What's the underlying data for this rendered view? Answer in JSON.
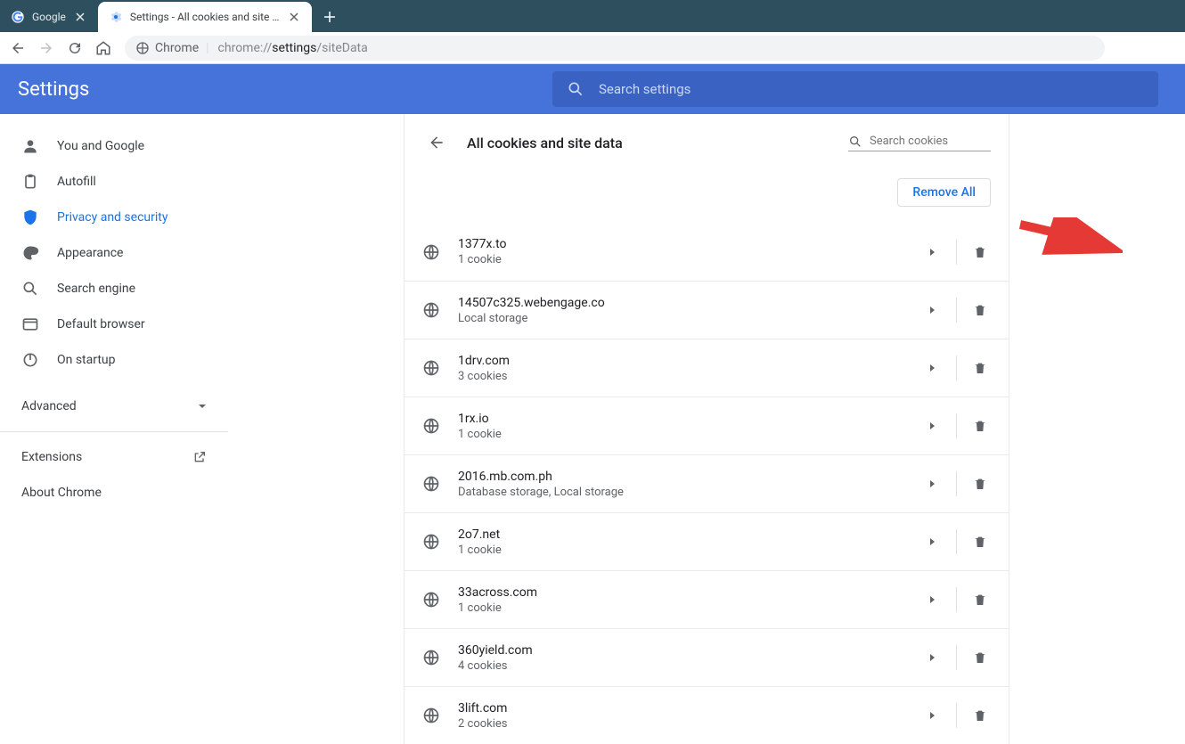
{
  "tabs": [
    {
      "title": "Google",
      "active": false
    },
    {
      "title": "Settings - All cookies and site da",
      "active": true
    }
  ],
  "omnibox": {
    "origin_label": "Chrome",
    "url_prefix": "chrome://",
    "url_bold": "settings",
    "url_suffix": "/siteData"
  },
  "header": {
    "title": "Settings",
    "search_placeholder": "Search settings"
  },
  "sidebar": {
    "items": [
      {
        "label": "You and Google",
        "icon": "person"
      },
      {
        "label": "Autofill",
        "icon": "clipboard"
      },
      {
        "label": "Privacy and security",
        "icon": "shield",
        "active": true
      },
      {
        "label": "Appearance",
        "icon": "palette"
      },
      {
        "label": "Search engine",
        "icon": "search"
      },
      {
        "label": "Default browser",
        "icon": "browser"
      },
      {
        "label": "On startup",
        "icon": "power"
      }
    ],
    "advanced_label": "Advanced",
    "extensions_label": "Extensions",
    "about_label": "About Chrome"
  },
  "main": {
    "back_aria": "Back",
    "title": "All cookies and site data",
    "search_placeholder": "Search cookies",
    "remove_all_label": "Remove All",
    "sites": [
      {
        "domain": "1377x.to",
        "detail": "1 cookie"
      },
      {
        "domain": "14507c325.webengage.co",
        "detail": "Local storage"
      },
      {
        "domain": "1drv.com",
        "detail": "3 cookies"
      },
      {
        "domain": "1rx.io",
        "detail": "1 cookie"
      },
      {
        "domain": "2016.mb.com.ph",
        "detail": "Database storage, Local storage"
      },
      {
        "domain": "2o7.net",
        "detail": "1 cookie"
      },
      {
        "domain": "33across.com",
        "detail": "1 cookie"
      },
      {
        "domain": "360yield.com",
        "detail": "4 cookies"
      },
      {
        "domain": "3lift.com",
        "detail": "2 cookies"
      }
    ]
  }
}
